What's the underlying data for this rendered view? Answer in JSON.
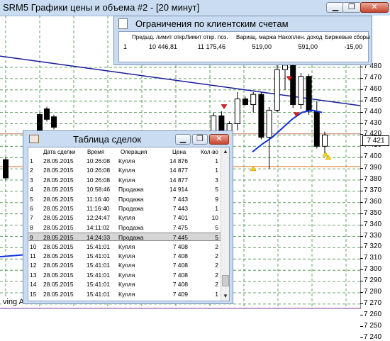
{
  "chart_window": {
    "title": "SRM5 Графики цены и объема #2 - [20 минут]",
    "indicator_label": "ving A",
    "current_price": "7 421",
    "price_ticks": [
      "7 480",
      "7 470",
      "7 460",
      "7 450",
      "7 440",
      "7 430",
      "7 420",
      "7 410",
      "7 400",
      "7 390",
      "7 380",
      "7 370",
      "7 360",
      "7 350",
      "7 340",
      "7 330",
      "7 320",
      "7 310",
      "7 300",
      "7 290",
      "7 280",
      "7 270",
      "7 260",
      "7 250",
      "7 240"
    ]
  },
  "chart_data": {
    "type": "candlestick",
    "title": "SRM5 Графики цены и объема #2 - [20 минут]",
    "y_unit": "price",
    "ylim": [
      7238,
      7492
    ],
    "current_price": 7421,
    "candles": [
      {
        "o": 7404,
        "h": 7422,
        "l": 7395,
        "c": 7410
      },
      {
        "o": 7410,
        "h": 7440,
        "l": 7400,
        "c": 7437
      },
      {
        "o": 7437,
        "h": 7441,
        "l": 7400,
        "c": 7402
      },
      {
        "o": 7402,
        "h": 7432,
        "l": 7398,
        "c": 7430
      },
      {
        "o": 7430,
        "h": 7458,
        "l": 7424,
        "c": 7452
      },
      {
        "o": 7452,
        "h": 7454,
        "l": 7446,
        "c": 7447
      },
      {
        "o": 7447,
        "h": 7458,
        "l": 7440,
        "c": 7456
      },
      {
        "o": 7456,
        "h": 7458,
        "l": 7416,
        "c": 7418
      },
      {
        "o": 7418,
        "h": 7445,
        "l": 7390,
        "c": 7442
      },
      {
        "o": 7442,
        "h": 7484,
        "l": 7440,
        "c": 7478
      },
      {
        "o": 7478,
        "h": 7485,
        "l": 7460,
        "c": 7482
      },
      {
        "o": 7482,
        "h": 7488,
        "l": 7444,
        "c": 7447
      },
      {
        "o": 7447,
        "h": 7475,
        "l": 7443,
        "c": 7472
      },
      {
        "o": 7472,
        "h": 7474,
        "l": 7438,
        "c": 7441
      },
      {
        "o": 7441,
        "h": 7450,
        "l": 7408,
        "c": 7410
      },
      {
        "o": 7410,
        "h": 7423,
        "l": 7402,
        "c": 7420
      }
    ],
    "blue_trend_line": [
      [
        7490,
        7446
      ]
    ],
    "moving_average": [
      7405,
      7412,
      7418,
      7426,
      7434,
      7440,
      7442,
      7440
    ]
  },
  "limits_window": {
    "title": "Ограничения по клиентским счетам",
    "columns": [
      "Предыд. лимит откр.",
      "Лимит откр. поз.",
      "Вариац. маржа",
      "Накоплен. доход",
      "Биржевые сборы"
    ],
    "row": {
      "index": "1",
      "values": [
        "10 446,81",
        "11 175,46",
        "519,00",
        "591,00",
        "-15,00"
      ]
    }
  },
  "trades_window": {
    "title": "Таблица сделок",
    "columns": [
      "",
      "Дата сделки",
      "Время",
      "Операция",
      "Цена",
      "Кол-во"
    ],
    "rows": [
      [
        "1",
        "28.05.2015",
        "10:26:08",
        "Купля",
        "14 876",
        "1"
      ],
      [
        "2",
        "28.05.2015",
        "10:26:08",
        "Купля",
        "14 877",
        "1"
      ],
      [
        "3",
        "28.05.2015",
        "10:26:08",
        "Купля",
        "14 877",
        "3"
      ],
      [
        "4",
        "28.05.2015",
        "10:58:46",
        "Продажа",
        "14 914",
        "5"
      ],
      [
        "5",
        "28.05.2015",
        "11:16:40",
        "Продажа",
        "7 443",
        "9"
      ],
      [
        "6",
        "28.05.2015",
        "11:16:40",
        "Продажа",
        "7 443",
        "1"
      ],
      [
        "7",
        "28.05.2015",
        "12:24:47",
        "Купля",
        "7 401",
        "10"
      ],
      [
        "8",
        "28.05.2015",
        "14:11:02",
        "Продажа",
        "7 475",
        "5"
      ],
      [
        "9",
        "28.05.2015",
        "14:24:33",
        "Продажа",
        "7 445",
        "5"
      ],
      [
        "10",
        "28.05.2015",
        "15:41:01",
        "Купля",
        "7 408",
        "2"
      ],
      [
        "11",
        "28.05.2015",
        "15:41:01",
        "Купля",
        "7 408",
        "2"
      ],
      [
        "12",
        "28.05.2015",
        "15:41:01",
        "Купля",
        "7 408",
        "2"
      ],
      [
        "13",
        "28.05.2015",
        "15:41:01",
        "Купля",
        "7 408",
        "2"
      ],
      [
        "14",
        "28.05.2015",
        "15:41:01",
        "Купля",
        "7 408",
        "2"
      ],
      [
        "15",
        "28.05.2015",
        "15:41:01",
        "Купля",
        "7 409",
        "1"
      ]
    ],
    "selected_row": 9
  },
  "window_buttons": {
    "minimize": "▁",
    "restore": "❐",
    "close": "✕"
  },
  "colors": {
    "grid": "#3a8a3a",
    "trend": "#1a1a9a",
    "ma": "#1030e0",
    "up_marker": "#ffd400",
    "down_marker": "#e02020",
    "titlebar": "#c9dcf2"
  }
}
